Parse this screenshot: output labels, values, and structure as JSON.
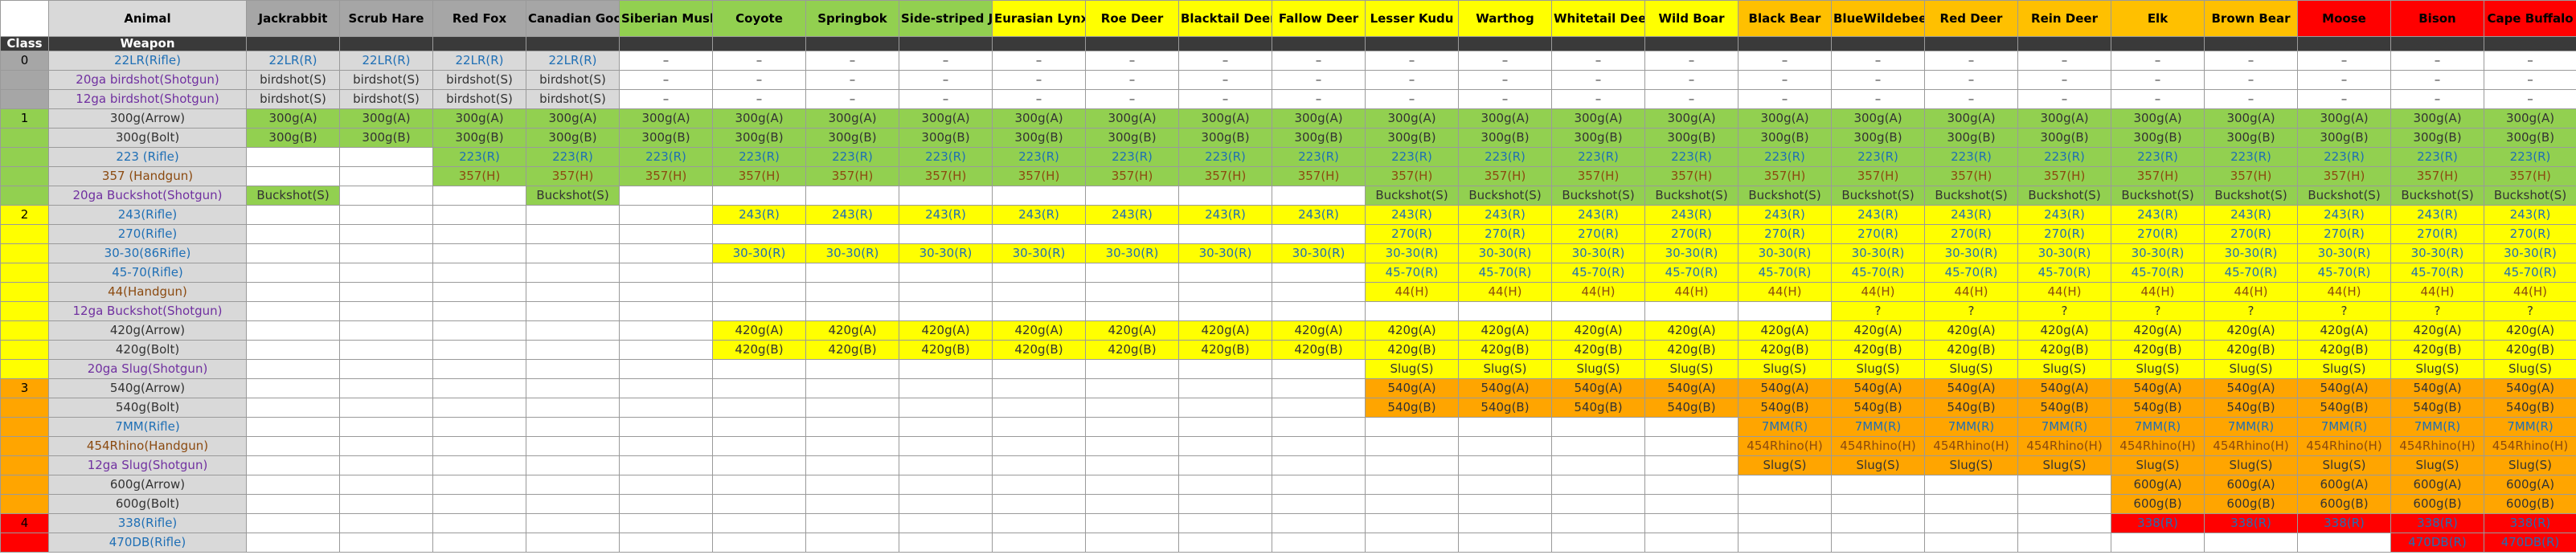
{
  "colors": {
    "white": "#ffffff",
    "grey": "#a6a6a6",
    "light_grey": "#d9d9d9",
    "green": "#92d050",
    "yellow": "#ffff00",
    "gold": "#ffc000",
    "orange": "#ffa500",
    "red": "#ff0000",
    "header_band": "#3a3a3a"
  },
  "header": {
    "corner": "",
    "animal_label": "Animal",
    "class_label": "Class",
    "weapon_label": "Weapon",
    "animals": [
      "Jackrabbit",
      "Scrub Hare",
      "Red Fox",
      "Canadian Goose",
      "Siberian Musk Deer",
      "Coyote",
      "Springbok",
      "Side-striped Jackal",
      "Eurasian Lynx",
      "Roe Deer",
      "Blacktail Deer",
      "Fallow Deer",
      "Lesser Kudu",
      "Warthog",
      "Whitetail Deer",
      "Wild Boar",
      "Black Bear",
      "BlueWildebeest",
      "Red Deer",
      "Rein Deer",
      "Elk",
      "Brown Bear",
      "Moose",
      "Bison",
      "Cape Buffalo"
    ]
  },
  "rows": [
    {
      "cls": "0",
      "weapon": "22LR(Rifle)",
      "cells": [
        "22LR(R)",
        "22LR(R)",
        "22LR(R)",
        "22LR(R)",
        "–",
        "–",
        "–",
        "–",
        "–",
        "–",
        "–",
        "–",
        "–",
        "–",
        "–",
        "–",
        "–",
        "–",
        "–",
        "–",
        "–",
        "–",
        "–",
        "–",
        "–"
      ]
    },
    {
      "cls": "",
      "weapon": "20ga birdshot(Shotgun)",
      "cells": [
        "birdshot(S)",
        "birdshot(S)",
        "birdshot(S)",
        "birdshot(S)",
        "–",
        "–",
        "–",
        "–",
        "–",
        "–",
        "–",
        "–",
        "–",
        "–",
        "–",
        "–",
        "–",
        "–",
        "–",
        "–",
        "–",
        "–",
        "–",
        "–",
        "–"
      ]
    },
    {
      "cls": "",
      "weapon": "12ga birdshot(Shotgun)",
      "cells": [
        "birdshot(S)",
        "birdshot(S)",
        "birdshot(S)",
        "birdshot(S)",
        "–",
        "–",
        "–",
        "–",
        "–",
        "–",
        "–",
        "–",
        "–",
        "–",
        "–",
        "–",
        "–",
        "–",
        "–",
        "–",
        "–",
        "–",
        "–",
        "–",
        "–"
      ]
    },
    {
      "cls": "1",
      "weapon": "300g(Arrow)",
      "cells": [
        "300g(A)",
        "300g(A)",
        "300g(A)",
        "300g(A)",
        "300g(A)",
        "300g(A)",
        "300g(A)",
        "300g(A)",
        "300g(A)",
        "300g(A)",
        "300g(A)",
        "300g(A)",
        "300g(A)",
        "300g(A)",
        "300g(A)",
        "300g(A)",
        "300g(A)",
        "300g(A)",
        "300g(A)",
        "300g(A)",
        "300g(A)",
        "300g(A)",
        "300g(A)",
        "300g(A)",
        "300g(A)"
      ]
    },
    {
      "cls": "",
      "weapon": "300g(Bolt)",
      "cells": [
        "300g(B)",
        "300g(B)",
        "300g(B)",
        "300g(B)",
        "300g(B)",
        "300g(B)",
        "300g(B)",
        "300g(B)",
        "300g(B)",
        "300g(B)",
        "300g(B)",
        "300g(B)",
        "300g(B)",
        "300g(B)",
        "300g(B)",
        "300g(B)",
        "300g(B)",
        "300g(B)",
        "300g(B)",
        "300g(B)",
        "300g(B)",
        "300g(B)",
        "300g(B)",
        "300g(B)",
        "300g(B)"
      ]
    },
    {
      "cls": "",
      "weapon": "223 (Rifle)",
      "cells": [
        "",
        "",
        "223(R)",
        "223(R)",
        "223(R)",
        "223(R)",
        "223(R)",
        "223(R)",
        "223(R)",
        "223(R)",
        "223(R)",
        "223(R)",
        "223(R)",
        "223(R)",
        "223(R)",
        "223(R)",
        "223(R)",
        "223(R)",
        "223(R)",
        "223(R)",
        "223(R)",
        "223(R)",
        "223(R)",
        "223(R)",
        "223(R)"
      ]
    },
    {
      "cls": "",
      "weapon": "357 (Handgun)",
      "cells": [
        "",
        "",
        "357(H)",
        "357(H)",
        "357(H)",
        "357(H)",
        "357(H)",
        "357(H)",
        "357(H)",
        "357(H)",
        "357(H)",
        "357(H)",
        "357(H)",
        "357(H)",
        "357(H)",
        "357(H)",
        "357(H)",
        "357(H)",
        "357(H)",
        "357(H)",
        "357(H)",
        "357(H)",
        "357(H)",
        "357(H)",
        "357(H)"
      ]
    },
    {
      "cls": "",
      "weapon": "20ga Buckshot(Shotgun)",
      "cells": [
        "Buckshot(S)",
        "",
        "",
        "Buckshot(S)",
        "",
        "",
        "",
        "",
        "",
        "",
        "",
        "",
        "Buckshot(S)",
        "Buckshot(S)",
        "Buckshot(S)",
        "Buckshot(S)",
        "Buckshot(S)",
        "Buckshot(S)",
        "Buckshot(S)",
        "Buckshot(S)",
        "Buckshot(S)",
        "Buckshot(S)",
        "Buckshot(S)",
        "Buckshot(S)",
        "Buckshot(S)"
      ]
    },
    {
      "cls": "2",
      "weapon": "243(Rifle)",
      "cells": [
        "",
        "",
        "",
        "",
        "",
        "243(R)",
        "243(R)",
        "243(R)",
        "243(R)",
        "243(R)",
        "243(R)",
        "243(R)",
        "243(R)",
        "243(R)",
        "243(R)",
        "243(R)",
        "243(R)",
        "243(R)",
        "243(R)",
        "243(R)",
        "243(R)",
        "243(R)",
        "243(R)",
        "243(R)",
        "243(R)"
      ]
    },
    {
      "cls": "",
      "weapon": "270(Rifle)",
      "cells": [
        "",
        "",
        "",
        "",
        "",
        "",
        "",
        "",
        "",
        "",
        "",
        "",
        "270(R)",
        "270(R)",
        "270(R)",
        "270(R)",
        "270(R)",
        "270(R)",
        "270(R)",
        "270(R)",
        "270(R)",
        "270(R)",
        "270(R)",
        "270(R)",
        "270(R)"
      ]
    },
    {
      "cls": "",
      "weapon": "30-30(86Rifle)",
      "cells": [
        "",
        "",
        "",
        "",
        "",
        "30-30(R)",
        "30-30(R)",
        "30-30(R)",
        "30-30(R)",
        "30-30(R)",
        "30-30(R)",
        "30-30(R)",
        "30-30(R)",
        "30-30(R)",
        "30-30(R)",
        "30-30(R)",
        "30-30(R)",
        "30-30(R)",
        "30-30(R)",
        "30-30(R)",
        "30-30(R)",
        "30-30(R)",
        "30-30(R)",
        "30-30(R)",
        "30-30(R)"
      ]
    },
    {
      "cls": "",
      "weapon": "45-70(Rifle)",
      "cells": [
        "",
        "",
        "",
        "",
        "",
        "",
        "",
        "",
        "",
        "",
        "",
        "",
        "45-70(R)",
        "45-70(R)",
        "45-70(R)",
        "45-70(R)",
        "45-70(R)",
        "45-70(R)",
        "45-70(R)",
        "45-70(R)",
        "45-70(R)",
        "45-70(R)",
        "45-70(R)",
        "45-70(R)",
        "45-70(R)"
      ]
    },
    {
      "cls": "",
      "weapon": "44(Handgun)",
      "cells": [
        "",
        "",
        "",
        "",
        "",
        "",
        "",
        "",
        "",
        "",
        "",
        "",
        "44(H)",
        "44(H)",
        "44(H)",
        "44(H)",
        "44(H)",
        "44(H)",
        "44(H)",
        "44(H)",
        "44(H)",
        "44(H)",
        "44(H)",
        "44(H)",
        "44(H)"
      ]
    },
    {
      "cls": "",
      "weapon": "12ga Buckshot(Shotgun)",
      "cells": [
        "",
        "",
        "",
        "",
        "",
        "",
        "",
        "",
        "",
        "",
        "",
        "",
        "",
        "",
        "",
        "",
        "",
        "?",
        "?",
        "?",
        "?",
        "?",
        "?",
        "?",
        "?"
      ]
    },
    {
      "cls": "",
      "weapon": "420g(Arrow)",
      "cells": [
        "",
        "",
        "",
        "",
        "",
        "420g(A)",
        "420g(A)",
        "420g(A)",
        "420g(A)",
        "420g(A)",
        "420g(A)",
        "420g(A)",
        "420g(A)",
        "420g(A)",
        "420g(A)",
        "420g(A)",
        "420g(A)",
        "420g(A)",
        "420g(A)",
        "420g(A)",
        "420g(A)",
        "420g(A)",
        "420g(A)",
        "420g(A)",
        "420g(A)"
      ]
    },
    {
      "cls": "",
      "weapon": "420g(Bolt)",
      "cells": [
        "",
        "",
        "",
        "",
        "",
        "420g(B)",
        "420g(B)",
        "420g(B)",
        "420g(B)",
        "420g(B)",
        "420g(B)",
        "420g(B)",
        "420g(B)",
        "420g(B)",
        "420g(B)",
        "420g(B)",
        "420g(B)",
        "420g(B)",
        "420g(B)",
        "420g(B)",
        "420g(B)",
        "420g(B)",
        "420g(B)",
        "420g(B)",
        "420g(B)"
      ]
    },
    {
      "cls": "",
      "weapon": "20ga Slug(Shotgun)",
      "cells": [
        "",
        "",
        "",
        "",
        "",
        "",
        "",
        "",
        "",
        "",
        "",
        "",
        "Slug(S)",
        "Slug(S)",
        "Slug(S)",
        "Slug(S)",
        "Slug(S)",
        "Slug(S)",
        "Slug(S)",
        "Slug(S)",
        "Slug(S)",
        "Slug(S)",
        "Slug(S)",
        "Slug(S)",
        "Slug(S)"
      ]
    },
    {
      "cls": "3",
      "weapon": "540g(Arrow)",
      "cells": [
        "",
        "",
        "",
        "",
        "",
        "",
        "",
        "",
        "",
        "",
        "",
        "",
        "540g(A)",
        "540g(A)",
        "540g(A)",
        "540g(A)",
        "540g(A)",
        "540g(A)",
        "540g(A)",
        "540g(A)",
        "540g(A)",
        "540g(A)",
        "540g(A)",
        "540g(A)",
        "540g(A)"
      ]
    },
    {
      "cls": "",
      "weapon": "540g(Bolt)",
      "cells": [
        "",
        "",
        "",
        "",
        "",
        "",
        "",
        "",
        "",
        "",
        "",
        "",
        "540g(B)",
        "540g(B)",
        "540g(B)",
        "540g(B)",
        "540g(B)",
        "540g(B)",
        "540g(B)",
        "540g(B)",
        "540g(B)",
        "540g(B)",
        "540g(B)",
        "540g(B)",
        "540g(B)"
      ]
    },
    {
      "cls": "",
      "weapon": "7MM(Rifle)",
      "cells": [
        "",
        "",
        "",
        "",
        "",
        "",
        "",
        "",
        "",
        "",
        "",
        "",
        "",
        "",
        "",
        "",
        "7MM(R)",
        "7MM(R)",
        "7MM(R)",
        "7MM(R)",
        "7MM(R)",
        "7MM(R)",
        "7MM(R)",
        "7MM(R)",
        "7MM(R)"
      ]
    },
    {
      "cls": "",
      "weapon": "454Rhino(Handgun)",
      "cells": [
        "",
        "",
        "",
        "",
        "",
        "",
        "",
        "",
        "",
        "",
        "",
        "",
        "",
        "",
        "",
        "",
        "454Rhino(H)",
        "454Rhino(H)",
        "454Rhino(H)",
        "454Rhino(H)",
        "454Rhino(H)",
        "454Rhino(H)",
        "454Rhino(H)",
        "454Rhino(H)",
        "454Rhino(H)"
      ]
    },
    {
      "cls": "",
      "weapon": "12ga Slug(Shotgun)",
      "cells": [
        "",
        "",
        "",
        "",
        "",
        "",
        "",
        "",
        "",
        "",
        "",
        "",
        "",
        "",
        "",
        "",
        "Slug(S)",
        "Slug(S)",
        "Slug(S)",
        "Slug(S)",
        "Slug(S)",
        "Slug(S)",
        "Slug(S)",
        "Slug(S)",
        "Slug(S)"
      ]
    },
    {
      "cls": "",
      "weapon": "600g(Arrow)",
      "cells": [
        "",
        "",
        "",
        "",
        "",
        "",
        "",
        "",
        "",
        "",
        "",
        "",
        "",
        "",
        "",
        "",
        "",
        "",
        "",
        "",
        "600g(A)",
        "600g(A)",
        "600g(A)",
        "600g(A)",
        "600g(A)"
      ]
    },
    {
      "cls": "",
      "weapon": "600g(Bolt)",
      "cells": [
        "",
        "",
        "",
        "",
        "",
        "",
        "",
        "",
        "",
        "",
        "",
        "",
        "",
        "",
        "",
        "",
        "",
        "",
        "",
        "",
        "600g(B)",
        "600g(B)",
        "600g(B)",
        "600g(B)",
        "600g(B)"
      ]
    },
    {
      "cls": "4",
      "weapon": "338(Rifle)",
      "cells": [
        "",
        "",
        "",
        "",
        "",
        "",
        "",
        "",
        "",
        "",
        "",
        "",
        "",
        "",
        "",
        "",
        "",
        "",
        "",
        "",
        "338(R)",
        "338(R)",
        "338(R)",
        "338(R)",
        "338(R)"
      ]
    },
    {
      "cls": "",
      "weapon": "470DB(Rifle)",
      "cells": [
        "",
        "",
        "",
        "",
        "",
        "",
        "",
        "",
        "",
        "",
        "",
        "",
        "",
        "",
        "",
        "",
        "",
        "",
        "",
        "",
        "",
        "",
        "",
        "470DB(R)",
        "470DB(R)"
      ]
    }
  ]
}
